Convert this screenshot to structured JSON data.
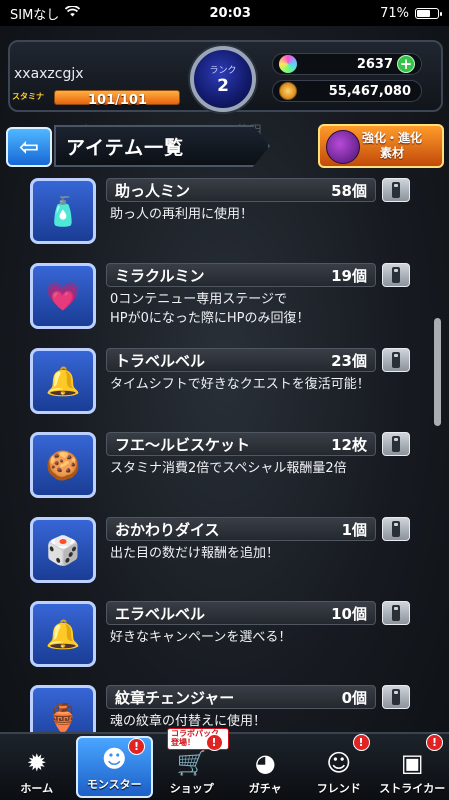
{
  "status_bar": {
    "carrier": "SIMなし",
    "time": "20:03",
    "battery": "71%",
    "battery_level": 0.71
  },
  "player": {
    "name": "xxaxzcgjx",
    "stamina_label": "スタミナ",
    "stamina_text": "101/101",
    "stamina_fill": 1.0,
    "rank_label": "ランク",
    "rank_value": "2",
    "orbs": "2637",
    "coins": "55,467,080"
  },
  "header": {
    "back_arrow": "⇦",
    "title": "アイテム一覧",
    "faint_text": "クエストのコンテニューに使用",
    "evolve_button": {
      "line1": "強化・進化",
      "line2": "素材"
    }
  },
  "items": [
    {
      "name": "助っ人ミン",
      "count": "58個",
      "desc1": "助っ人の再利用に使用！",
      "desc2": "",
      "icon": "helper-min-icon",
      "glyph": "🧴"
    },
    {
      "name": "ミラクルミン",
      "count": "19個",
      "desc1": "0コンテニュー専用ステージで",
      "desc2": "HPが0になった際にHPのみ回復！",
      "icon": "miracle-min-icon",
      "glyph": "💗"
    },
    {
      "name": "トラベルベル",
      "count": "23個",
      "desc1": "タイムシフトで好きなクエストを復活可能！",
      "desc2": "",
      "icon": "travel-bell-icon",
      "glyph": "🔔"
    },
    {
      "name": "フエ～ルビスケット",
      "count": "12枚",
      "desc1": "スタミナ消費2倍でスペシャル報酬量2倍",
      "desc2": "",
      "icon": "biscuit-icon",
      "glyph": "🍪"
    },
    {
      "name": "おかわりダイス",
      "count": "1個",
      "desc1": "出た目の数だけ報酬を追加！",
      "desc2": "",
      "icon": "dice-icon",
      "glyph": "🎲"
    },
    {
      "name": "エラベルベル",
      "count": "10個",
      "desc1": "好きなキャンペーンを選べる！",
      "desc2": "",
      "icon": "select-bell-icon",
      "glyph": "🔔"
    },
    {
      "name": "紋章チェンジャー",
      "count": "0個",
      "desc1": "魂の紋章の付替えに使用！",
      "desc2": "",
      "icon": "emblem-changer-icon",
      "glyph": "🏺"
    }
  ],
  "nav": [
    {
      "label": "ホーム",
      "icon": "home-icon",
      "glyph": "✹",
      "badge": "",
      "tag": ""
    },
    {
      "label": "モンスター",
      "icon": "monster-icon",
      "glyph": "☻",
      "badge": "!",
      "tag": ""
    },
    {
      "label": "ショップ",
      "icon": "shop-cart-icon",
      "glyph": "🛒",
      "badge": "!",
      "tag": "コラボパック登場！"
    },
    {
      "label": "ガチャ",
      "icon": "gacha-icon",
      "glyph": "◕",
      "badge": "",
      "tag": ""
    },
    {
      "label": "フレンド",
      "icon": "friend-icon",
      "glyph": "☺",
      "badge": "!",
      "tag": ""
    },
    {
      "label": "ストライカー",
      "icon": "striker-icon",
      "glyph": "▣",
      "badge": "!",
      "tag": ""
    }
  ]
}
